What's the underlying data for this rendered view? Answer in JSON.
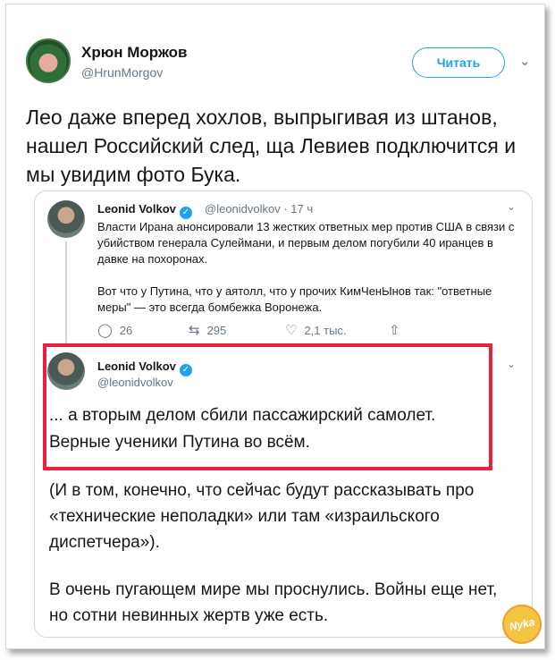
{
  "author": {
    "name": "Хрюн Моржов",
    "handle": "@HrunMorgov",
    "avatar_icon": "pig-avatar-icon"
  },
  "follow_button_label": "Читать",
  "tweet_text": "Лео даже вперед хохлов, выпрыгивая из штанов, нашел Российский след, ща Левиев подключится и мы увидим фото Бука.",
  "quoted": {
    "tweet1": {
      "name": "Leonid Volkov",
      "meta": "@leonidvolkov · 17 ч",
      "paragraph1": "Власти Ирана анонсировали 13 жестких ответных мер против США в связи с убийством генерала Сулеймани, и первым делом погубили 40 иранцев в давке на похоронах.",
      "paragraph2": "Вот что у Путина, что у аятолл, что у прочих КимЧенЫнов так: \"ответные меры\" — это всегда бомбежка Воронежа.",
      "actions": {
        "replies": "26",
        "retweets": "295",
        "likes": "2,1 тыс."
      }
    },
    "tweet2": {
      "name": "Leonid Volkov",
      "handle": "@leonidvolkov",
      "text": "... а вторым делом сбили пассажирский самолет. Верные ученики Путина во всём."
    },
    "continuation_p1": "(И в том, конечно, что сейчас будут рассказывать про «технические неполадки» или там «израильского диспетчера»).",
    "continuation_p2": "В очень пугающем мире мы проснулись. Войны еще нет, но сотни невинных жертв уже есть."
  },
  "watermark_text": "Nyka",
  "colors": {
    "accent": "#1da1f2",
    "highlight": "#e8203a",
    "secondary_text": "#657786"
  }
}
